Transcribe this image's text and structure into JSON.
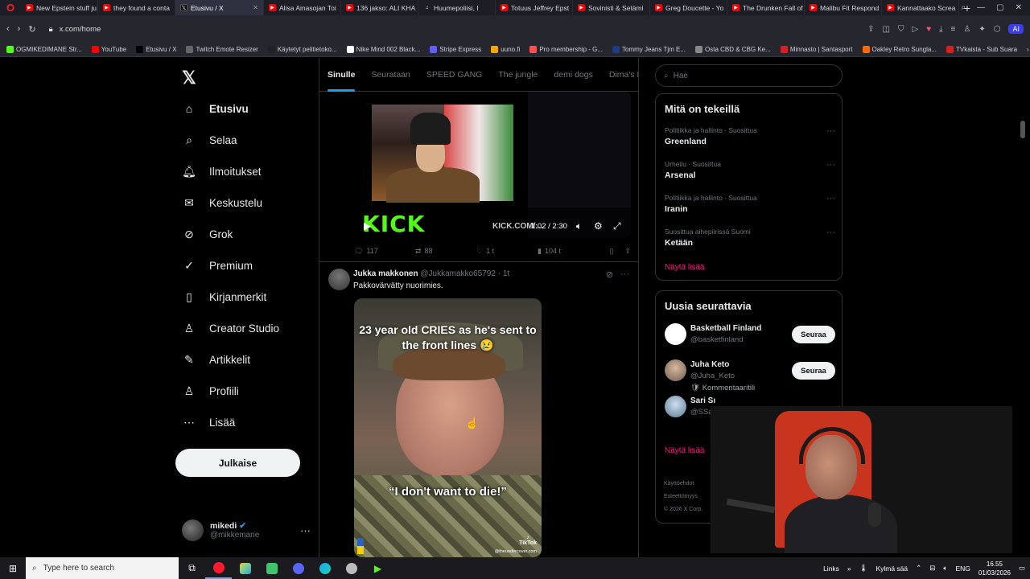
{
  "browser": {
    "tabs": [
      {
        "title": "New Epstein stuff ju",
        "fav": "youtube"
      },
      {
        "title": "they found a conta",
        "fav": "youtube"
      },
      {
        "title": "Etusivu / X",
        "fav": "x",
        "active": true
      },
      {
        "title": "Alisa Ainasojan Toi",
        "fav": "youtube"
      },
      {
        "title": "136 jakso: ALI KHA",
        "fav": "youtube"
      },
      {
        "title": "Huumepoliisi, I",
        "fav": "audio"
      },
      {
        "title": "Totuus Jeffrey Epst",
        "fav": "youtube"
      },
      {
        "title": "Sovinisti & Setämi",
        "fav": "youtube"
      },
      {
        "title": "Greg Doucette - Yo",
        "fav": "youtube"
      },
      {
        "title": "The Drunken Fall of",
        "fav": "youtube"
      },
      {
        "title": "Malibu Fit Respond",
        "fav": "youtube"
      },
      {
        "title": "Kannattaako Screa",
        "fav": "youtube"
      }
    ],
    "url": "x.com/home",
    "ai_label": "AI",
    "bookmarks": [
      {
        "label": "OGMIKEDIMANE Str...",
        "color": "#53fc18"
      },
      {
        "label": "YouTube",
        "color": "#ff0000"
      },
      {
        "label": "Etusivu / X",
        "color": "#000000"
      },
      {
        "label": "Twitch Emote Resizer",
        "color": "#666666"
      },
      {
        "label": "Käytetyt pelitietoko...",
        "color": "#222222"
      },
      {
        "label": "Nike Mind 002 Black...",
        "color": "#ffffff"
      },
      {
        "label": "Stripe Express",
        "color": "#635bff"
      },
      {
        "label": "uuno.fi",
        "color": "#f7a600"
      },
      {
        "label": "Pro membership - G...",
        "color": "#ff4f4f"
      },
      {
        "label": "Tommy Jeans Tjm E...",
        "color": "#1b3c8c"
      },
      {
        "label": "Osta CBD & CBG Ke...",
        "color": "#888888"
      },
      {
        "label": "Minnasto | Santasport",
        "color": "#d62020"
      },
      {
        "label": "Oakley Retro Sungla...",
        "color": "#ff6a00"
      },
      {
        "label": "TVkaista - Sub Suara",
        "color": "#d62020"
      }
    ]
  },
  "nav": {
    "items": [
      {
        "label": "Etusivu",
        "icon": "home-icon",
        "glyph": "⌂",
        "bold": true
      },
      {
        "label": "Selaa",
        "icon": "search-icon",
        "glyph": "⌕"
      },
      {
        "label": "Ilmoitukset",
        "icon": "bell-icon",
        "glyph": "🔔︎"
      },
      {
        "label": "Keskustelu",
        "icon": "mail-icon",
        "glyph": "✉"
      },
      {
        "label": "Grok",
        "icon": "grok-icon",
        "glyph": "⊘"
      },
      {
        "label": "Premium",
        "icon": "verified-icon",
        "glyph": "✓"
      },
      {
        "label": "Kirjanmerkit",
        "icon": "bookmark-icon",
        "glyph": "▯"
      },
      {
        "label": "Creator Studio",
        "icon": "creator-studio-icon",
        "glyph": "♙"
      },
      {
        "label": "Artikkelit",
        "icon": "articles-icon",
        "glyph": "✎"
      },
      {
        "label": "Profiili",
        "icon": "profile-icon",
        "glyph": "♙"
      },
      {
        "label": "Lisää",
        "icon": "more-circle-icon",
        "glyph": "⋯"
      }
    ],
    "post_button": "Julkaise",
    "account": {
      "name": "mikedi",
      "handle": "@mikkemane"
    }
  },
  "feed": {
    "tabs": [
      "Sinulle",
      "Seurataan",
      "SPEED GANG",
      "The jungle",
      "demi dogs",
      "Dima's Dist"
    ],
    "post1": {
      "kick_logo": "KICK",
      "kick_url": "KICK.COM/…",
      "video_time": "1:02 / 2:30",
      "replies": "117",
      "reposts": "88",
      "likes": "1 t",
      "views": "104 t"
    },
    "post2": {
      "name": "Jukka makkonen",
      "handle": "@Jukkamakko65792",
      "time": "1t",
      "text": "Pakkovärvätty nuorimies.",
      "caption_top": "23 year old CRIES as he's sent to the front lines 😢",
      "caption_bottom": "“I don't want to die!”",
      "tiktok": "TikTok",
      "tiktok_handle": "@theundercover.com"
    }
  },
  "sidebar": {
    "search_placeholder": "Hae",
    "trends_title": "Mitä on tekeillä",
    "trends": [
      {
        "category": "Politiikka ja hallinto · Suosittua",
        "name": "Greenland"
      },
      {
        "category": "Urheilu · Suosittua",
        "name": "Arsenal"
      },
      {
        "category": "Politiikka ja hallinto · Suosittua",
        "name": "Iranin"
      },
      {
        "category": "Suosittua aihepiirissä Suomi",
        "name": "Ketään"
      }
    ],
    "show_more": "Näytä lisää",
    "wtf_title": "Uusia seurattavia",
    "wtf": [
      {
        "name": "Basketball Finland",
        "handle": "@basketfinland",
        "extra": "",
        "button": "Seuraa"
      },
      {
        "name": "Juha Keto",
        "handle": "@Juha_Keto",
        "extra": "🛡 Kommentaaritili",
        "button": "Seuraa"
      },
      {
        "name": "Sari Sı",
        "handle": "@SSa",
        "extra": "",
        "button": ""
      }
    ],
    "footer": [
      "Käyttöehdot",
      "Esteettömyys",
      "© 2026 X Corp."
    ]
  },
  "taskbar": {
    "search_placeholder": "Type here to search",
    "links": "Links",
    "weather": "Kylmä sää",
    "lang": "ENG",
    "time": "16.55",
    "date": "01/03/2026"
  }
}
